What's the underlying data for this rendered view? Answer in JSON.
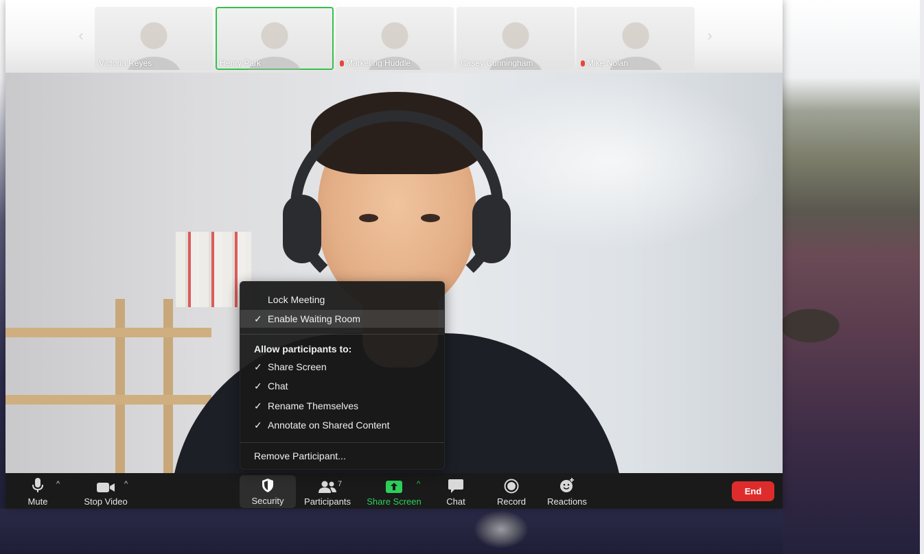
{
  "participants_strip": {
    "thumbnails": [
      {
        "name": "Victoria Reyes",
        "muted": false,
        "active": false
      },
      {
        "name": "Henry Park",
        "muted": false,
        "active": true
      },
      {
        "name": "Marketing Huddle",
        "muted": true,
        "active": false
      },
      {
        "name": "Casey Cunningham",
        "muted": false,
        "active": false
      },
      {
        "name": "Mike Nolan",
        "muted": true,
        "active": false
      }
    ]
  },
  "security_menu": {
    "lock_meeting": {
      "label": "Lock Meeting",
      "checked": false
    },
    "enable_waiting_room": {
      "label": "Enable Waiting Room",
      "checked": true
    },
    "allow_heading": "Allow participants to:",
    "allow_items": [
      {
        "label": "Share Screen",
        "checked": true
      },
      {
        "label": "Chat",
        "checked": true
      },
      {
        "label": "Rename Themselves",
        "checked": true
      },
      {
        "label": "Annotate on Shared Content",
        "checked": true
      }
    ],
    "remove_participant": "Remove Participant...",
    "check_glyph": "✓"
  },
  "toolbar": {
    "mute": {
      "label": "Mute",
      "icon": "microphone-icon"
    },
    "stop_video": {
      "label": "Stop Video",
      "icon": "video-camera-icon"
    },
    "security": {
      "label": "Security",
      "icon": "shield-icon"
    },
    "participants": {
      "label": "Participants",
      "count": "7",
      "icon": "participants-icon"
    },
    "share_screen": {
      "label": "Share Screen",
      "icon": "share-screen-icon"
    },
    "chat": {
      "label": "Chat",
      "icon": "chat-bubble-icon"
    },
    "record": {
      "label": "Record",
      "icon": "record-icon"
    },
    "reactions": {
      "label": "Reactions",
      "icon": "add-reaction-icon"
    },
    "end": {
      "label": "End"
    },
    "caret_glyph": "^"
  },
  "colors": {
    "accent_green": "#2ecf5b",
    "end_red": "#de2c2c",
    "toolbar_bg": "#1a1a1a",
    "menu_bg": "#1a1a1a"
  }
}
